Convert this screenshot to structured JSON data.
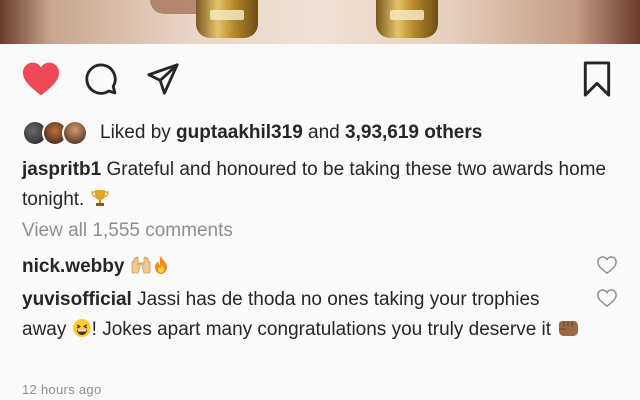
{
  "post": {
    "likes": {
      "prefix": "Liked by ",
      "first_user": "guptaakhil319",
      "middle": " and ",
      "count": "3,93,619 others"
    },
    "caption": {
      "username": "jaspritb1",
      "text": " Grateful and honoured to be taking these two awards home tonight."
    },
    "view_all_comments": "View all 1,555 comments",
    "comments": [
      {
        "username": "nick.webby",
        "text": ""
      },
      {
        "username": "yuvisofficial",
        "text_part1": " Jassi has de thoda no ones taking your trophies away ",
        "text_part2": "! Jokes apart many congratulations you truly deserve it "
      }
    ],
    "timestamp": "12 hours ago"
  },
  "colors": {
    "like_red": "#ed4956",
    "muted": "#8e8e8e",
    "text": "#262626"
  },
  "icons": [
    "heart-filled-icon",
    "comment-icon",
    "share-icon",
    "bookmark-icon",
    "comment-heart-icon"
  ]
}
